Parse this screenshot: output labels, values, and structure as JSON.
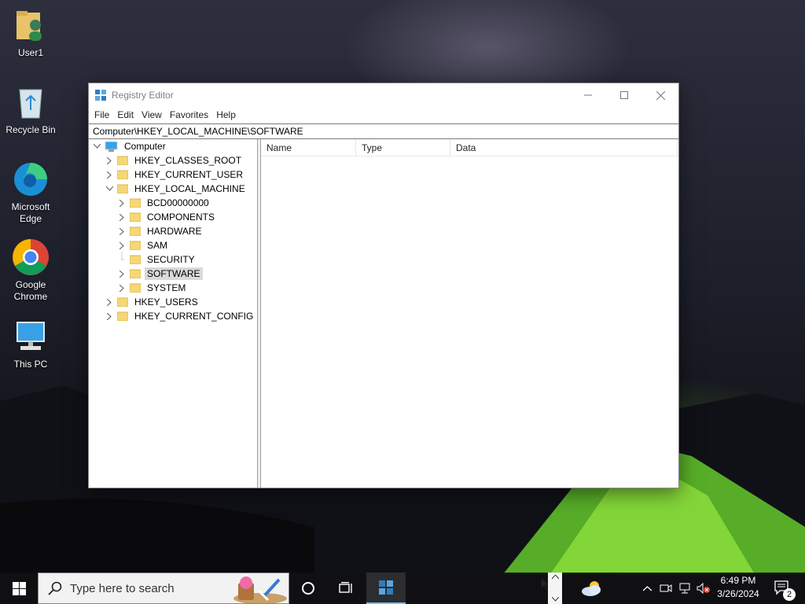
{
  "desktop": {
    "icons": [
      {
        "label": "User1",
        "icon": "user-folder-icon"
      },
      {
        "label": "Recycle Bin",
        "icon": "recycle-bin-icon"
      },
      {
        "label": "Microsoft Edge",
        "icon": "edge-icon"
      },
      {
        "label": "Google Chrome",
        "icon": "chrome-icon"
      },
      {
        "label": "This PC",
        "icon": "computer-icon"
      }
    ]
  },
  "window": {
    "title": "Registry Editor",
    "menu": [
      "File",
      "Edit",
      "View",
      "Favorites",
      "Help"
    ],
    "address": "Computer\\HKEY_LOCAL_MACHINE\\SOFTWARE",
    "tree": {
      "root": "Computer",
      "hives": [
        "HKEY_CLASSES_ROOT",
        "HKEY_CURRENT_USER",
        "HKEY_LOCAL_MACHINE",
        "HKEY_USERS",
        "HKEY_CURRENT_CONFIG"
      ],
      "hklm_children": [
        "BCD00000000",
        "COMPONENTS",
        "HARDWARE",
        "SAM",
        "SECURITY",
        "SOFTWARE",
        "SYSTEM"
      ],
      "selected": "SOFTWARE"
    },
    "columns": [
      "Name",
      "Type",
      "Data"
    ]
  },
  "taskbar": {
    "search_placeholder": "Type here to search",
    "time": "6:49 PM",
    "date": "3/26/2024",
    "notification_count": "2"
  }
}
